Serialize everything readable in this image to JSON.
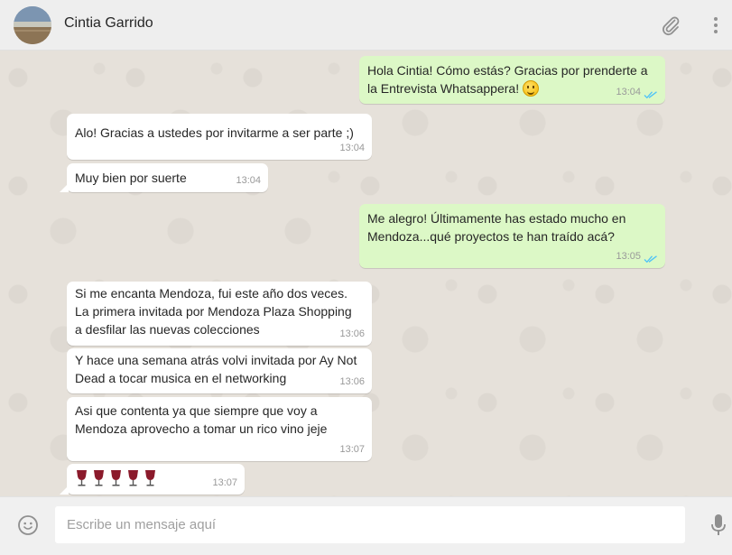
{
  "header": {
    "contact_name": "Cintia Garrido",
    "icons": [
      "avatar",
      "paperclip-icon",
      "menu-icon"
    ]
  },
  "messages": [
    {
      "direction": "out",
      "line1": "Hola Cintia! Cómo estás? Gracias por prenderte a",
      "line2": "la Entrevista Whatsappera!",
      "emoji": "smile",
      "time": "13:04",
      "status": "read"
    },
    {
      "direction": "in",
      "text": "Alo! Gracias a ustedes por invitarme a ser parte ;)",
      "time": "13:04"
    },
    {
      "direction": "in",
      "text": "Muy bien por suerte",
      "time": "13:04"
    },
    {
      "direction": "out",
      "line1": "Me alegro! Últimamente has estado mucho en",
      "line2": "Mendoza...qué proyectos te han traído acá?",
      "time": "13:05",
      "status": "read"
    },
    {
      "direction": "in",
      "line1": "Si me encanta Mendoza, fui este año dos veces.",
      "line2": "La primera invitada por Mendoza Plaza Shopping",
      "line3": "a desfilar las nuevas colecciones",
      "time": "13:06"
    },
    {
      "direction": "in",
      "line1": "Y hace una semana atrás volvi invitada por Ay Not",
      "line2": "Dead a tocar musica en el networking",
      "time": "13:06"
    },
    {
      "direction": "in",
      "line1": "Asi que contenta ya que siempre que voy a",
      "line2": "Mendoza aprovecho a tomar un rico vino jeje",
      "time": "13:07"
    },
    {
      "direction": "in",
      "emoji": "wine-glass",
      "emoji_count": 5,
      "time": "13:07"
    }
  ],
  "composer": {
    "placeholder": "Escribe un mensaje aquí",
    "icons": [
      "smiley-icon",
      "microphone-icon"
    ]
  },
  "colors": {
    "header_bg": "#eeeeee",
    "chat_bg": "#e6e1da",
    "outgoing_bubble": "#dcf8c6",
    "incoming_bubble": "#ffffff",
    "read_ticks": "#4fc3f7"
  }
}
